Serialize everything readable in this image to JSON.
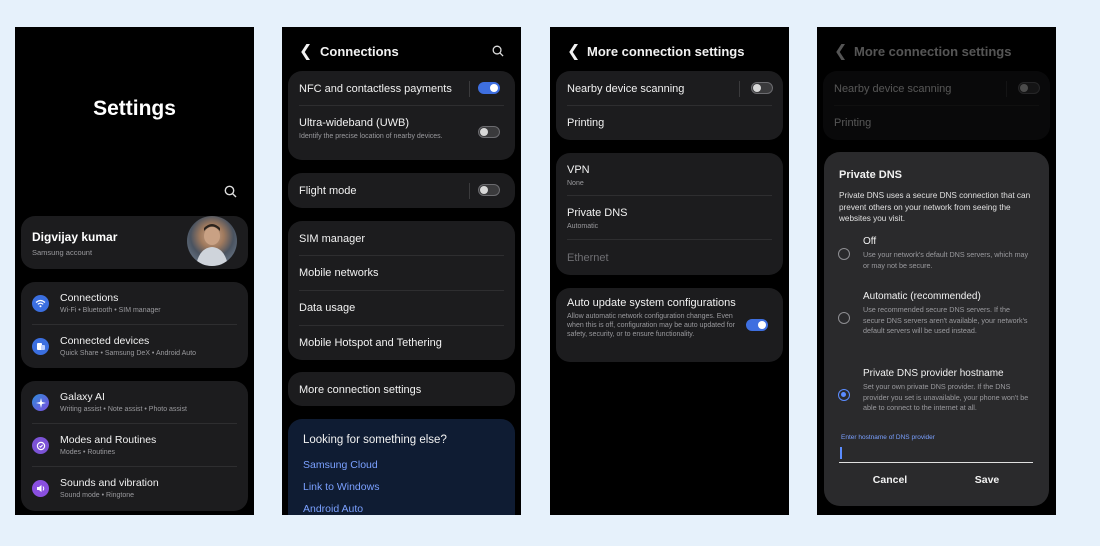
{
  "screen1": {
    "title": "Settings",
    "account": {
      "name": "Digvijay kumar",
      "sub": "Samsung account"
    },
    "groups": [
      [
        {
          "label": "Connections",
          "sub": "Wi-Fi  •  Bluetooth  •  SIM manager",
          "icon": "wifi-icon",
          "color": "#3b6fe0"
        },
        {
          "label": "Connected devices",
          "sub": "Quick Share  •  Samsung DeX  •  Android Auto",
          "icon": "connected-devices-icon",
          "color": "#3b6fe0"
        }
      ],
      [
        {
          "label": "Galaxy AI",
          "sub": "Writing assist  •  Note assist  •  Photo assist",
          "icon": "galaxy-ai-icon",
          "color": "#2f8bd8"
        },
        {
          "label": "Modes and Routines",
          "sub": "Modes  •  Routines",
          "icon": "modes-icon",
          "color": "#7c53d6"
        },
        {
          "label": "Sounds and vibration",
          "sub": "Sound mode  •  Ringtone",
          "icon": "sound-icon",
          "color": "#8a4fe0"
        }
      ]
    ]
  },
  "screen2": {
    "title": "Connections",
    "nfc": {
      "label": "NFC and contactless payments",
      "on": true
    },
    "uwb": {
      "label": "Ultra-wideband (UWB)",
      "sub": "Identify the precise location of nearby devices.",
      "on": false
    },
    "flight": {
      "label": "Flight mode",
      "on": false
    },
    "list": [
      "SIM manager",
      "Mobile networks",
      "Data usage",
      "Mobile Hotspot and Tethering"
    ],
    "more": "More connection settings",
    "suggest": {
      "heading": "Looking for something else?",
      "links": [
        "Samsung Cloud",
        "Link to Windows",
        "Android Auto"
      ]
    }
  },
  "screen3": {
    "title": "More connection settings",
    "nearby": {
      "label": "Nearby device scanning",
      "on": false
    },
    "printing": "Printing",
    "vpn": {
      "label": "VPN",
      "sub": "None"
    },
    "dns": {
      "label": "Private DNS",
      "sub": "Automatic"
    },
    "ethernet": "Ethernet",
    "auto": {
      "label": "Auto update system configurations",
      "sub": "Allow automatic network configuration changes. Even when this is off, configuration may be auto updated for safety, security, or to ensure functionality.",
      "on": true
    }
  },
  "screen4": {
    "title": "More connection settings",
    "nearby": "Nearby device scanning",
    "printing": "Printing",
    "dialog": {
      "title": "Private DNS",
      "desc": "Private DNS uses a secure DNS connection that can prevent others on your network from seeing the websites you visit.",
      "options": [
        {
          "label": "Off",
          "sub": "Use your network's default DNS servers, which may or may not be secure.",
          "selected": false
        },
        {
          "label": "Automatic (recommended)",
          "sub": "Use recommended secure DNS servers. If the secure DNS servers aren't available, your network's default servers will be used instead.",
          "selected": false
        },
        {
          "label": "Private DNS provider hostname",
          "sub": "Set your own private DNS provider. If the DNS provider you set is unavailable, your phone won't be able to connect to the internet at all.",
          "selected": true
        }
      ],
      "input_label": "Enter hostname of DNS provider",
      "input_value": "",
      "cancel": "Cancel",
      "save": "Save"
    }
  }
}
